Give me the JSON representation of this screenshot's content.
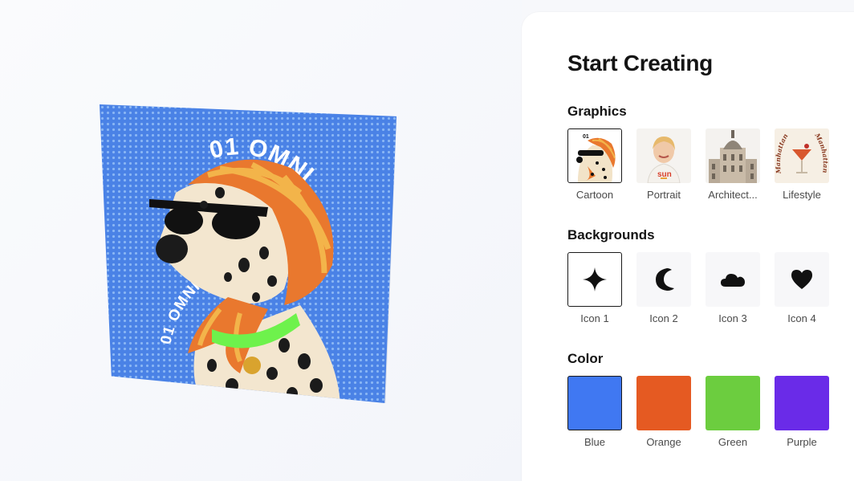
{
  "canvas": {
    "artwork_text_top": "01 OMNI",
    "artwork_text_side": "01 OMNI"
  },
  "panel": {
    "title": "Start Creating",
    "graphics": {
      "title": "Graphics",
      "items": [
        {
          "label": "Cartoon",
          "selected": true
        },
        {
          "label": "Portrait",
          "selected": false
        },
        {
          "label": "Architect...",
          "selected": false
        },
        {
          "label": "Lifestyle",
          "selected": false
        }
      ],
      "lifestyle_image_text": "Manhattan"
    },
    "backgrounds": {
      "title": "Backgrounds",
      "items": [
        {
          "label": "Icon 1",
          "icon": "sparkle-icon",
          "selected": true
        },
        {
          "label": "Icon 2",
          "icon": "moon-icon",
          "selected": false
        },
        {
          "label": "Icon 3",
          "icon": "cloud-icon",
          "selected": false
        },
        {
          "label": "Icon 4",
          "icon": "heart-icon",
          "selected": false
        }
      ]
    },
    "color": {
      "title": "Color",
      "items": [
        {
          "label": "Blue",
          "hex": "#4078f2",
          "selected": true
        },
        {
          "label": "Orange",
          "hex": "#e55a22",
          "selected": false
        },
        {
          "label": "Green",
          "hex": "#6ccd3f",
          "selected": false
        },
        {
          "label": "Purple",
          "hex": "#6a2be8",
          "selected": false
        }
      ]
    }
  }
}
